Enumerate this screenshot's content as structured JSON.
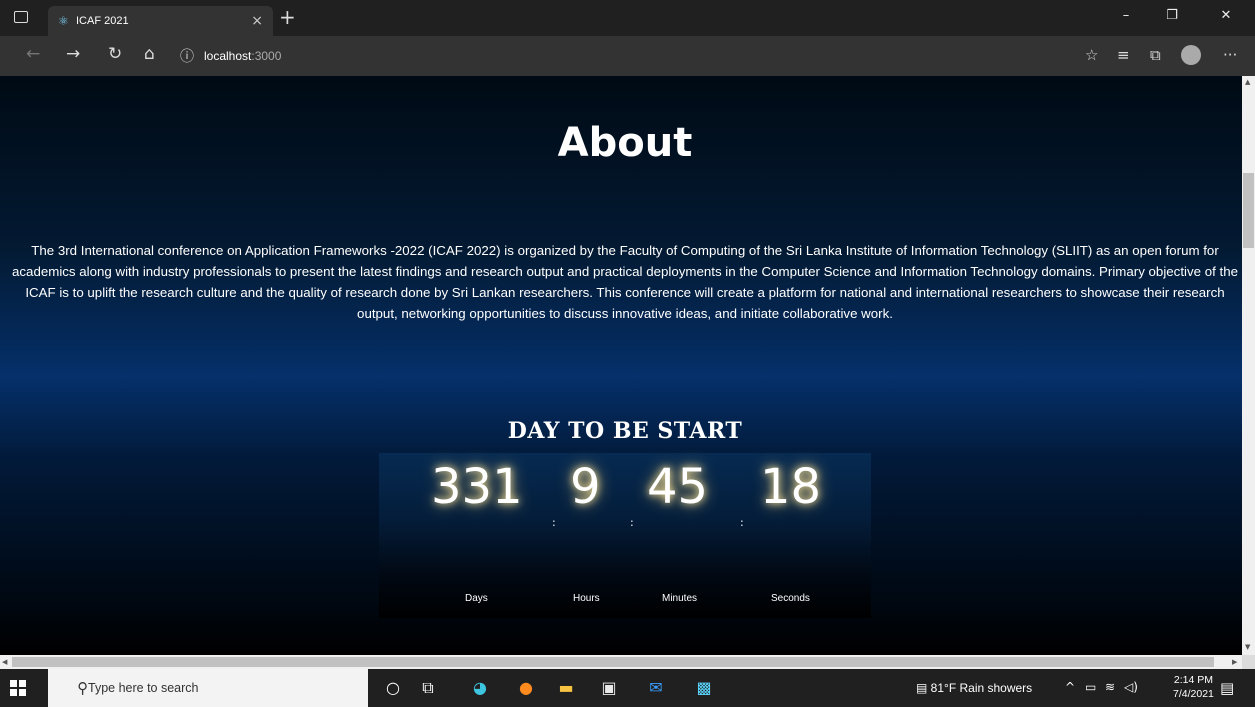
{
  "browser": {
    "tab_title": "ICAF 2021",
    "tab_favicon": "react-icon",
    "tab_close": "×",
    "new_tab": "+",
    "url_host": "localhost",
    "url_port": ":3000",
    "window_controls": [
      "–",
      "❐",
      "✕"
    ],
    "nav_buttons": [
      "back-icon",
      "forward-icon",
      "refresh-icon",
      "home-icon"
    ],
    "toolbar_icons": [
      "add-favorite-icon",
      "favorites-icon",
      "collections-icon",
      "profile-icon",
      "more-icon"
    ]
  },
  "page": {
    "about_title": "About",
    "about_text": "The 3rd International conference on Application Frameworks -2022 (ICAF 2022) is organized by the Faculty of Computing of the Sri Lanka Institute of Information Technology (SLIIT) as an open forum for academics along with industry professionals to present the latest findings and research output and practical deployments in the Computer Science and Information Technology domains. Primary objective of the ICAF is to uplift the research culture and the quality of research done by Sri Lankan researchers. This conference will create a platform for national and international researchers to showcase their research output, networking opportunities to discuss innovative ideas, and initiate collaborative work.",
    "countdown_title": "DAY TO BE START",
    "countdown": {
      "days": "331",
      "hours": "9",
      "minutes": "45",
      "seconds": "18",
      "separator": ":",
      "labels": {
        "days": "Days",
        "hours": "Hours",
        "minutes": "Minutes",
        "seconds": "Seconds"
      }
    }
  },
  "taskbar": {
    "search_placeholder": "Type here to search",
    "pinned_apps": [
      "cortana-icon",
      "task-view-icon",
      "edge-icon",
      "firefox-icon",
      "file-explorer-icon",
      "store-icon",
      "mail-icon",
      "webstorm-icon"
    ],
    "weather": "81°F  Rain showers",
    "time": "2:14 PM",
    "date": "7/4/2021"
  }
}
